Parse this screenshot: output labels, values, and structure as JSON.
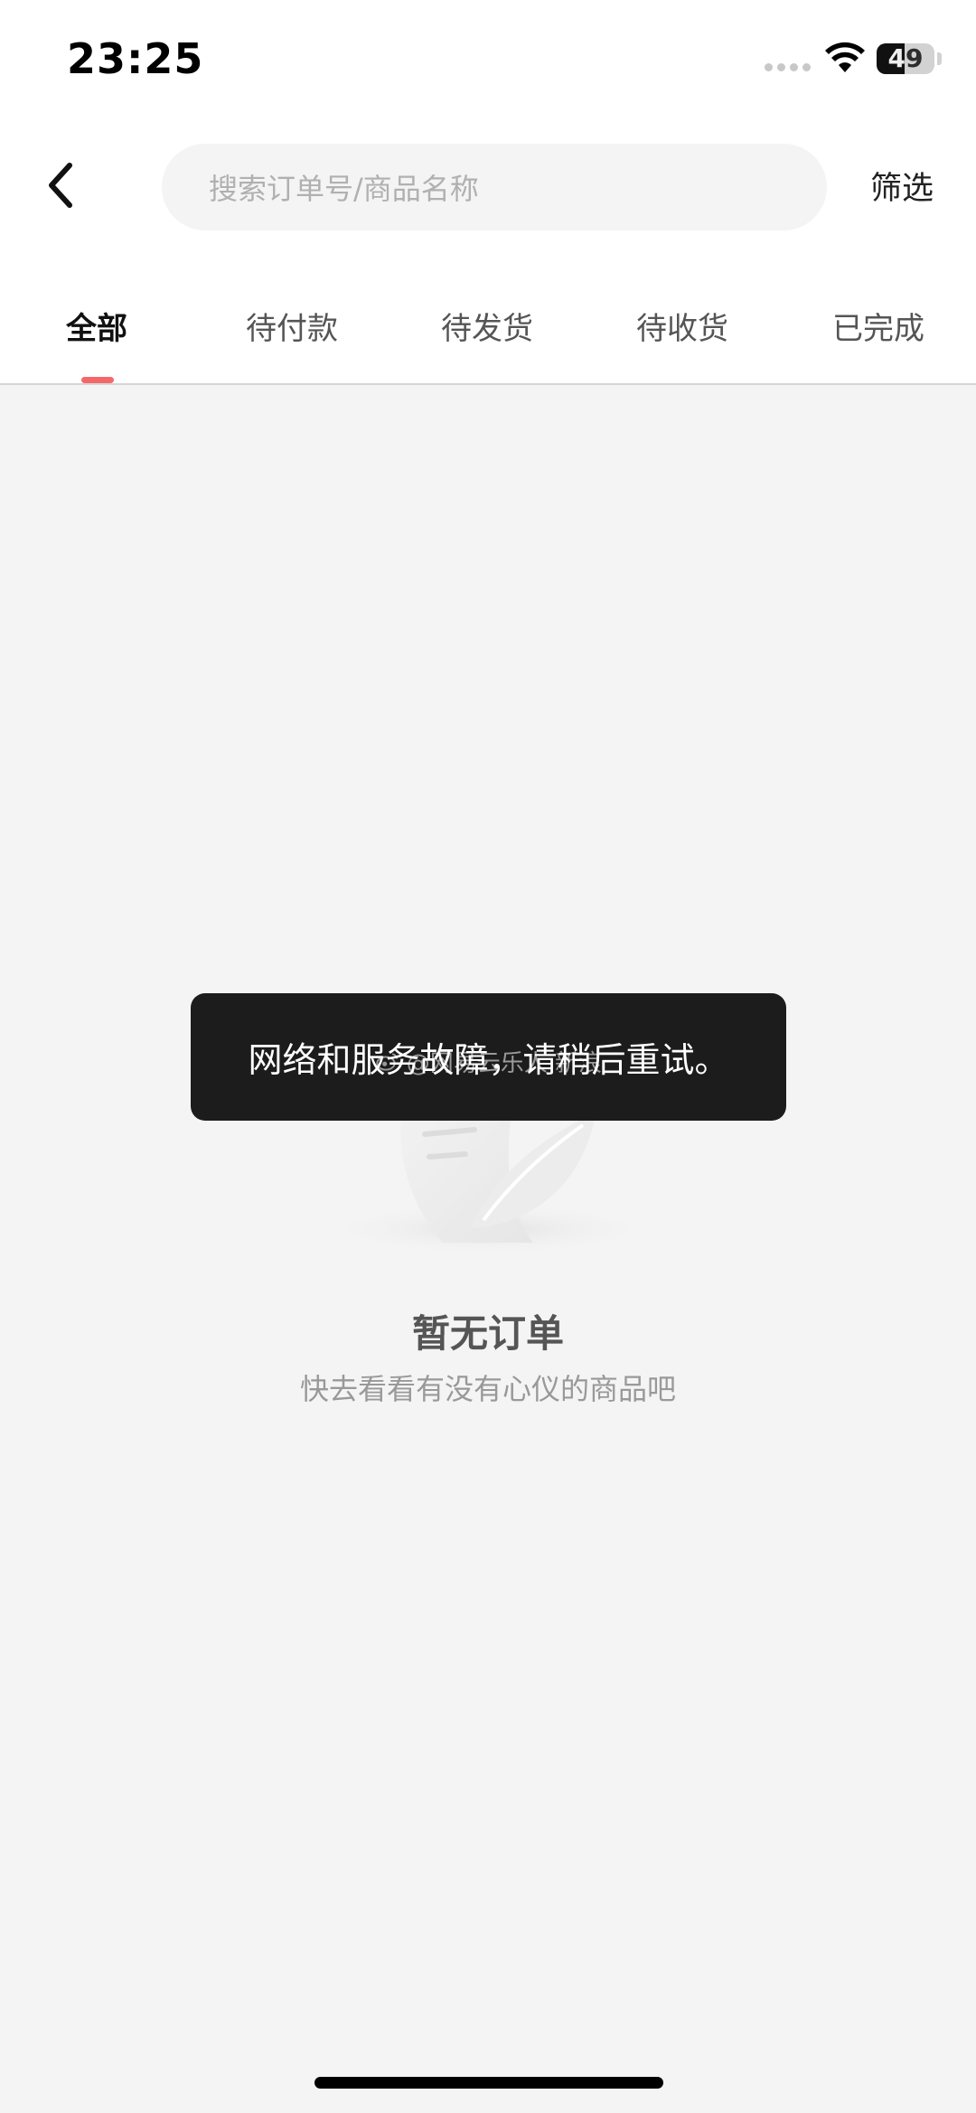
{
  "status_bar": {
    "time": "23:25",
    "battery_level": "49",
    "battery_fraction": 0.49,
    "icons": [
      "signal-dots-icon",
      "wifi-icon",
      "battery-icon"
    ]
  },
  "header": {
    "back_icon": "chevron-left-icon",
    "search_placeholder": "搜索订单号/商品名称",
    "filter_label": "筛选"
  },
  "tabs": {
    "items": [
      {
        "label": "全部",
        "active": true
      },
      {
        "label": "待付款",
        "active": false
      },
      {
        "label": "待发货",
        "active": false
      },
      {
        "label": "待收货",
        "active": false
      },
      {
        "label": "已完成",
        "active": false
      }
    ],
    "indicator_color": "#f4686a"
  },
  "empty_state": {
    "title": "暂无订单",
    "subtitle": "快去看看有没有心仪的商品吧",
    "illustration_icon": "feather-paper-illustration"
  },
  "toast": {
    "message": "网络和服务故障，请稍后重试。"
  },
  "watermark": {
    "text": "@网易云乐人 新浪",
    "icon": "weibo-logo-icon"
  },
  "colors": {
    "background": "#f4f4f4",
    "header_background": "#ffffff",
    "toast_background": "#1c1c1c",
    "accent": "#f4686a"
  }
}
